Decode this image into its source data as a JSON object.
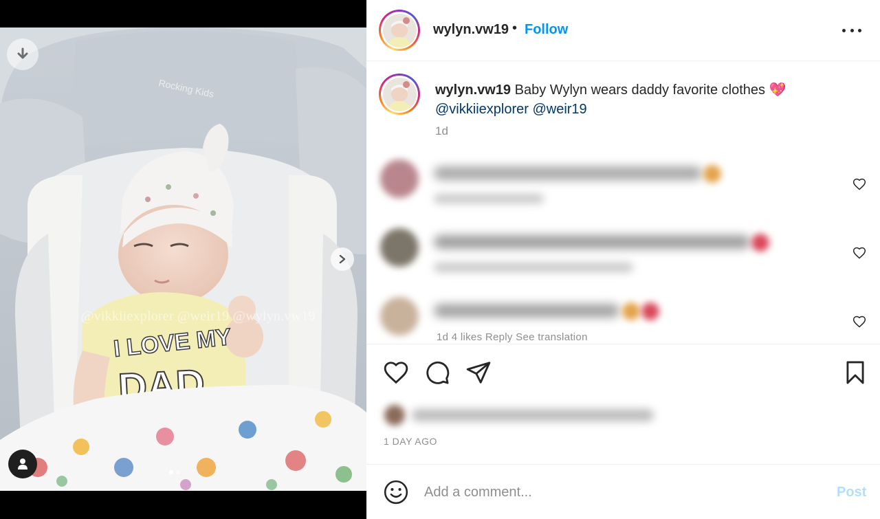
{
  "post": {
    "username": "wylyn.vw19",
    "separator": "•",
    "follow_label": "Follow",
    "more_icon": "more-horizontal-icon",
    "caption": {
      "username": "wylyn.vw19",
      "text": " Baby Wylyn wears daddy favorite clothes ",
      "emoji": "💖",
      "mention1": "@vikkiiexplorer",
      "mention2": "@weir19",
      "time": "1d"
    },
    "comments_peek": "1d    4 likes    Reply    See translation",
    "actions": {
      "like_icon": "heart-icon",
      "comment_icon": "comment-icon",
      "share_icon": "share-icon",
      "save_icon": "bookmark-icon"
    },
    "posted_ago": "1 DAY AGO",
    "add_comment": {
      "placeholder": "Add a comment...",
      "post_label": "Post",
      "emoji_icon": "emoji-icon"
    }
  },
  "media": {
    "watermark": "@vikkiiexplorer @weir19 @wylyn.vw19",
    "shirt_line1": "I LOVE MY",
    "shirt_line2": "DAD",
    "chair_logo": "Rocking Kids",
    "carousel_index": 1,
    "carousel_count": 2
  },
  "colors": {
    "follow": "#0095f6",
    "mention": "#00376b",
    "muted": "#8e8e8e",
    "post_disabled": "#b2dffc"
  }
}
